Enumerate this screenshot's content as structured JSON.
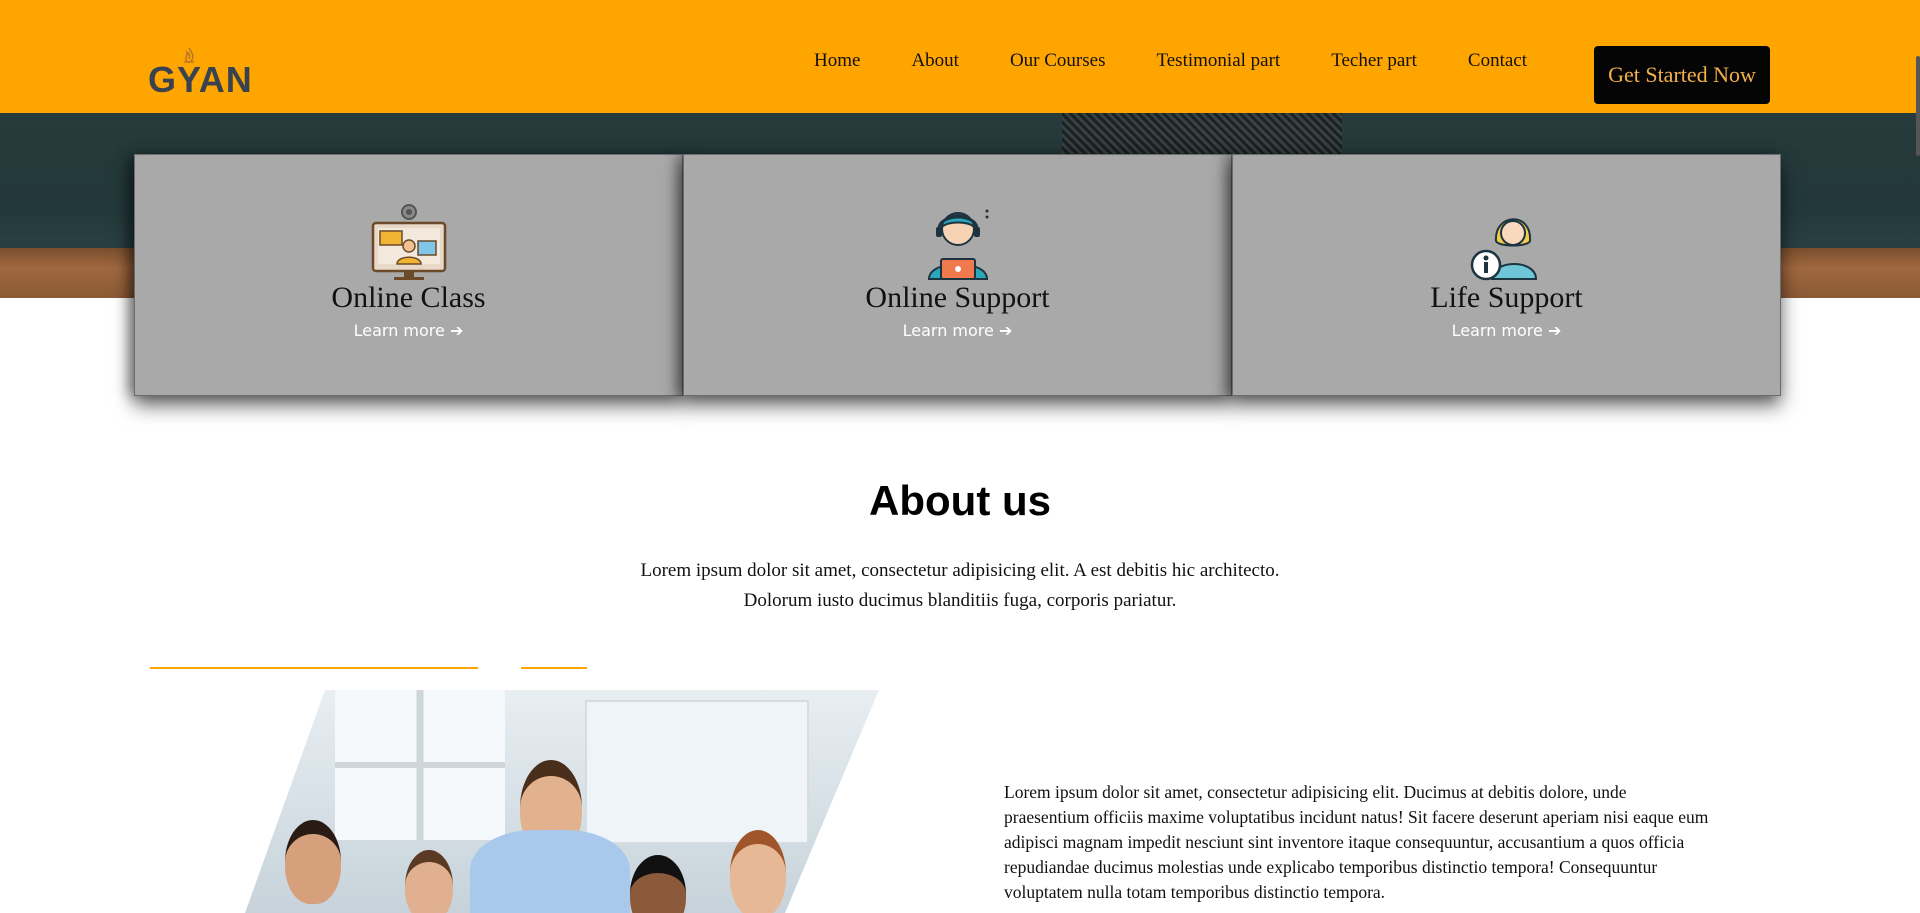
{
  "header": {
    "logo_text": "GYAN",
    "nav": [
      "Home",
      "About",
      "Our Courses",
      "Testimonial part",
      "Techer part",
      "Contact"
    ],
    "cta_label": "Get Started Now"
  },
  "features": [
    {
      "title": "Online Class",
      "link": "Learn more",
      "icon": "online-class-icon"
    },
    {
      "title": "Online Support",
      "link": "Learn more",
      "icon": "online-support-icon"
    },
    {
      "title": "Life Support",
      "link": "Learn more",
      "icon": "life-support-icon"
    }
  ],
  "about": {
    "title": "About us",
    "desc_line1": "Lorem ipsum dolor sit amet, consectetur adipisicing elit. A est debitis hic architecto.",
    "desc_line2": "Dolorum iusto ducimus blanditiis fuga, corporis pariatur.",
    "body": "Lorem ipsum dolor sit amet, consectetur adipisicing elit. Ducimus at debitis dolore, unde praesentium officiis maxime voluptatibus incidunt natus! Sit facere deserunt aperiam nisi eaque eum adipisci magnam impedit nesciunt sint inventore itaque consequuntur, accusantium a quos officia repudiandae ducimus molestias unde explicabo temporibus distinctio tempora! Consequuntur voluptatem nulla totam temporibus distinctio tempora."
  },
  "colors": {
    "accent": "#ffa500",
    "card_bg": "#a9a9a9",
    "cta_bg": "#050505",
    "cta_text": "#f4b04a"
  }
}
